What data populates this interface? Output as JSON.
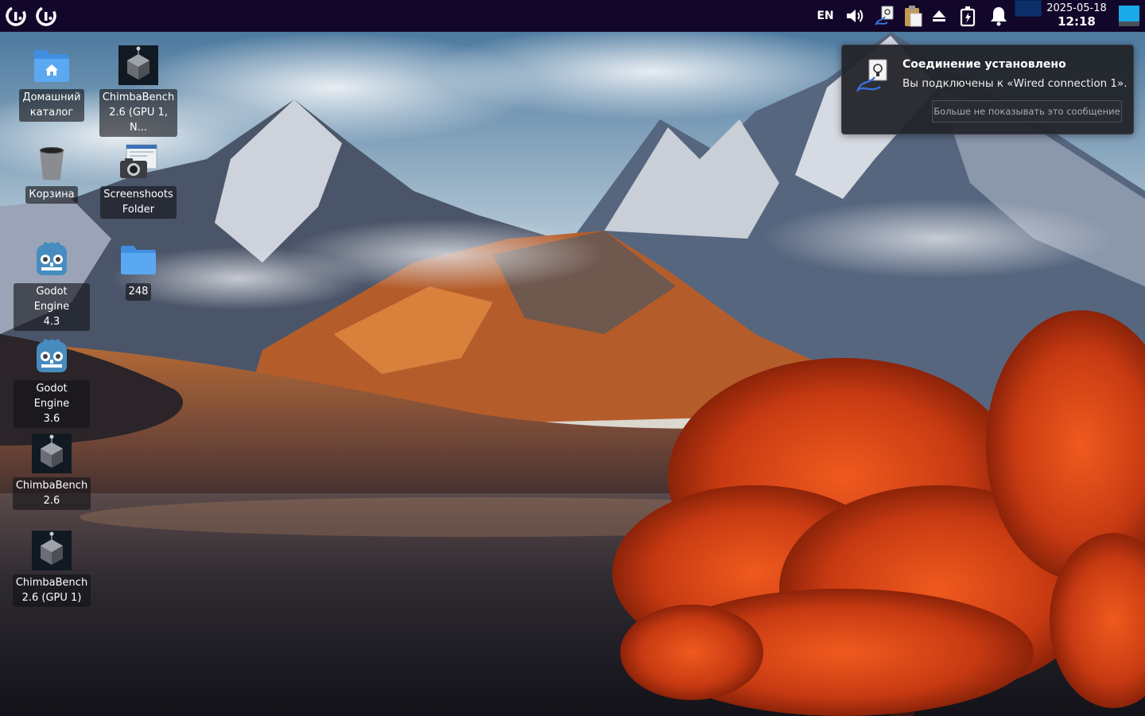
{
  "panel": {
    "background": "#12072a",
    "menu_buttons": [
      {
        "icon": "app-menu-icon"
      },
      {
        "icon": "app-menu-icon"
      }
    ],
    "tray": {
      "language": "EN",
      "icons": [
        "volume-icon",
        "network-wired-icon",
        "clipboard-icon",
        "eject-icon",
        "battery-icon",
        "bell-icon"
      ]
    },
    "clock": {
      "date": "2025-05-18",
      "time": "12:18"
    }
  },
  "desktop": {
    "icons": [
      {
        "label": "Домашний\nкаталог",
        "icon": "home-folder-icon"
      },
      {
        "label": "ChimbaBench\n2.6 (GPU 1, N...",
        "icon": "chimbabench-icon"
      },
      {
        "label": "Корзина",
        "icon": "trash-icon"
      },
      {
        "label": "Screenshoots\nFolder",
        "icon": "screenshot-camera-icon"
      },
      {
        "label": "Godot Engine\n4.3",
        "icon": "godot-icon"
      },
      {
        "label": "248",
        "icon": "folder-icon"
      },
      {
        "label": "Godot Engine\n3.6",
        "icon": "godot-icon"
      },
      {
        "label": "ChimbaBench\n2.6",
        "icon": "chimbabench-icon"
      },
      {
        "label": "ChimbaBench\n2.6 (GPU 1)",
        "icon": "chimbabench-icon"
      }
    ]
  },
  "notification": {
    "title": "Соединение установлено",
    "body": "Вы подключены к «Wired connection 1».",
    "button": "Больше не показывать это сообщение",
    "icon": "network-wired-icon"
  }
}
